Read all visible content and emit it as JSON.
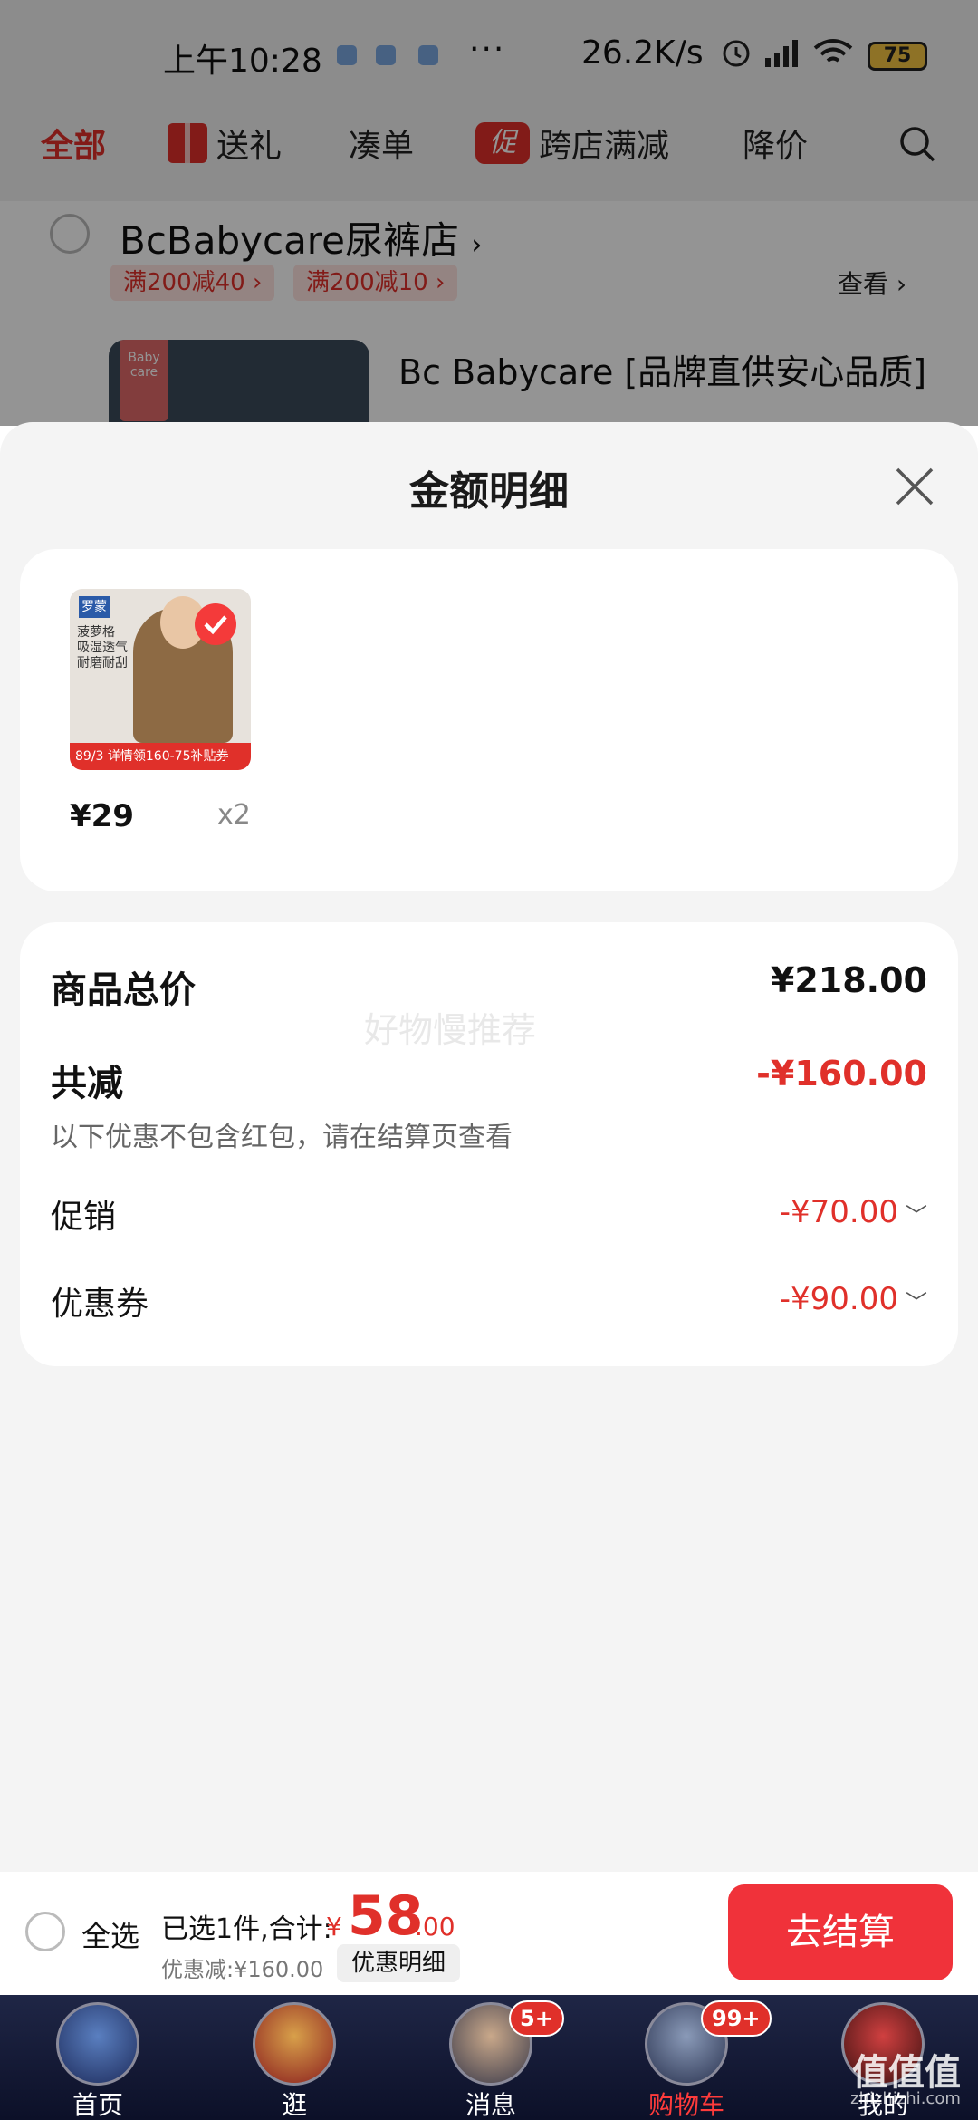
{
  "status_bar": {
    "time": "上午10:28",
    "more": "···",
    "network_speed": "26.2K/s",
    "battery": "75"
  },
  "top_tabs": [
    {
      "label": "全部"
    },
    {
      "label": "送礼"
    },
    {
      "label": "凑单"
    },
    {
      "label": "跨店满减",
      "badge": "促"
    },
    {
      "label": "降价"
    }
  ],
  "store": {
    "name": "BcBabycare尿裤店",
    "coupons": [
      "满200减40",
      "满200减10"
    ],
    "view_label": "查看",
    "product_title": "Bc Babycare [品牌直供安心品质]",
    "thumb_logo": "Baby care"
  },
  "sheet": {
    "title": "金额明细",
    "item": {
      "thumb_brand": "罗蒙",
      "thumb_text": "菠萝格 吸湿透气 耐磨耐刮",
      "thumb_banner": "89/3 详情领160-75补贴券",
      "price": "¥29",
      "qty": "x2"
    },
    "summary": {
      "total_label": "商品总价",
      "total_value": "¥218.00",
      "reduce_label": "共减",
      "reduce_value": "-¥160.00",
      "reduce_note": "以下优惠不包含红包，请在结算页查看",
      "promo_label": "促销",
      "promo_value": "-¥70.00",
      "coupon_label": "优惠券",
      "coupon_value": "-¥90.00",
      "watermark": "好物慢推荐"
    }
  },
  "checkout": {
    "select_all": "全选",
    "selected_summary": "已选1件,合计:",
    "currency": "¥",
    "total_int": "58",
    "total_dec": ".00",
    "discount_summary": "优惠减:¥160.00",
    "detail_button": "优惠明细",
    "checkout_button": "去结算"
  },
  "bottom_nav": [
    {
      "label": "首页",
      "active": false
    },
    {
      "label": "逛",
      "active": false
    },
    {
      "label": "消息",
      "active": false,
      "badge": "5+"
    },
    {
      "label": "购物车",
      "active": true,
      "badge": "99+"
    },
    {
      "label": "我的",
      "active": false
    }
  ],
  "site_watermark": {
    "main": "值值值",
    "sub": "zhizhizhi.com"
  },
  "colors": {
    "accent": "#e0302a",
    "checkout_button": "#f0323a",
    "nav_bg": "#1f2646"
  }
}
